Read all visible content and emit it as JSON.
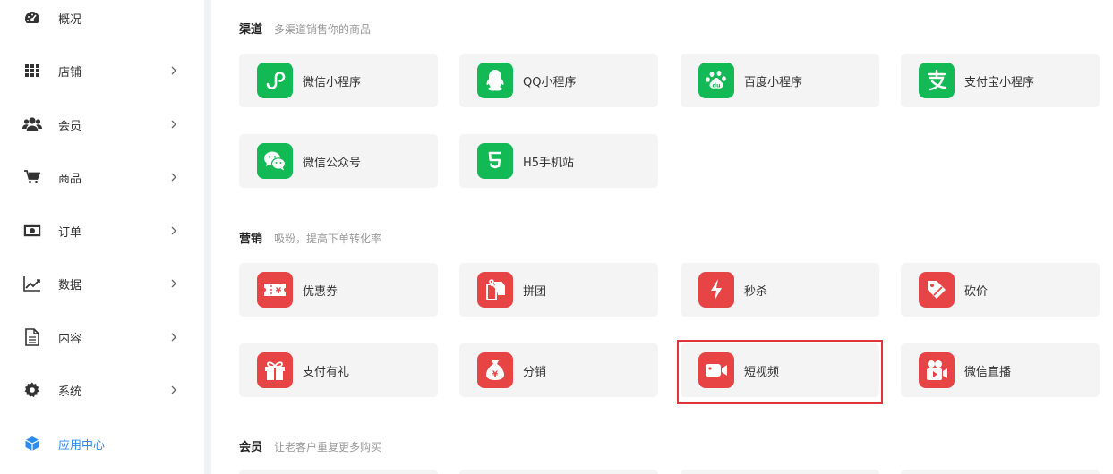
{
  "sidebar": {
    "items": [
      {
        "label": "概况",
        "icon": "dashboard-icon"
      },
      {
        "label": "店铺",
        "icon": "grid-icon"
      },
      {
        "label": "会员",
        "icon": "users-icon"
      },
      {
        "label": "商品",
        "icon": "cart-icon"
      },
      {
        "label": "订单",
        "icon": "money-icon"
      },
      {
        "label": "数据",
        "icon": "chart-line-icon"
      },
      {
        "label": "内容",
        "icon": "document-icon"
      },
      {
        "label": "系统",
        "icon": "gear-icon"
      },
      {
        "label": "应用中心",
        "icon": "cube-icon",
        "active": true
      }
    ]
  },
  "sections": [
    {
      "title": "渠道",
      "desc": "多渠道销售你的商品",
      "cards": [
        {
          "label": "微信小程序",
          "icon": "mini-program-icon"
        },
        {
          "label": "QQ小程序",
          "icon": "qq-penguin-icon"
        },
        {
          "label": "百度小程序",
          "icon": "baidu-paw-icon"
        },
        {
          "label": "支付宝小程序",
          "icon": "alipay-icon"
        },
        {
          "label": "微信公众号",
          "icon": "wechat-icon"
        },
        {
          "label": "H5手机站",
          "icon": "html5-icon"
        }
      ]
    },
    {
      "title": "营销",
      "desc": "吸粉，提高下单转化率",
      "cards": [
        {
          "label": "优惠券",
          "icon": "coupon-icon"
        },
        {
          "label": "拼团",
          "icon": "group-buy-icon"
        },
        {
          "label": "秒杀",
          "icon": "lightning-icon"
        },
        {
          "label": "砍价",
          "icon": "price-tag-icon"
        },
        {
          "label": "支付有礼",
          "icon": "gift-icon"
        },
        {
          "label": "分销",
          "icon": "money-bag-icon"
        },
        {
          "label": "短视频",
          "icon": "video-camera-icon",
          "selected": true
        },
        {
          "label": "微信直播",
          "icon": "live-camera-icon"
        }
      ]
    },
    {
      "title": "会员",
      "desc": "让老客户重复更多购买"
    }
  ],
  "colors": {
    "channel_icon_bg": "#13b955",
    "marketing_icon_bg": "#e74545",
    "active_nav": "#2d8cf0",
    "selection_border": "#e0353a"
  }
}
